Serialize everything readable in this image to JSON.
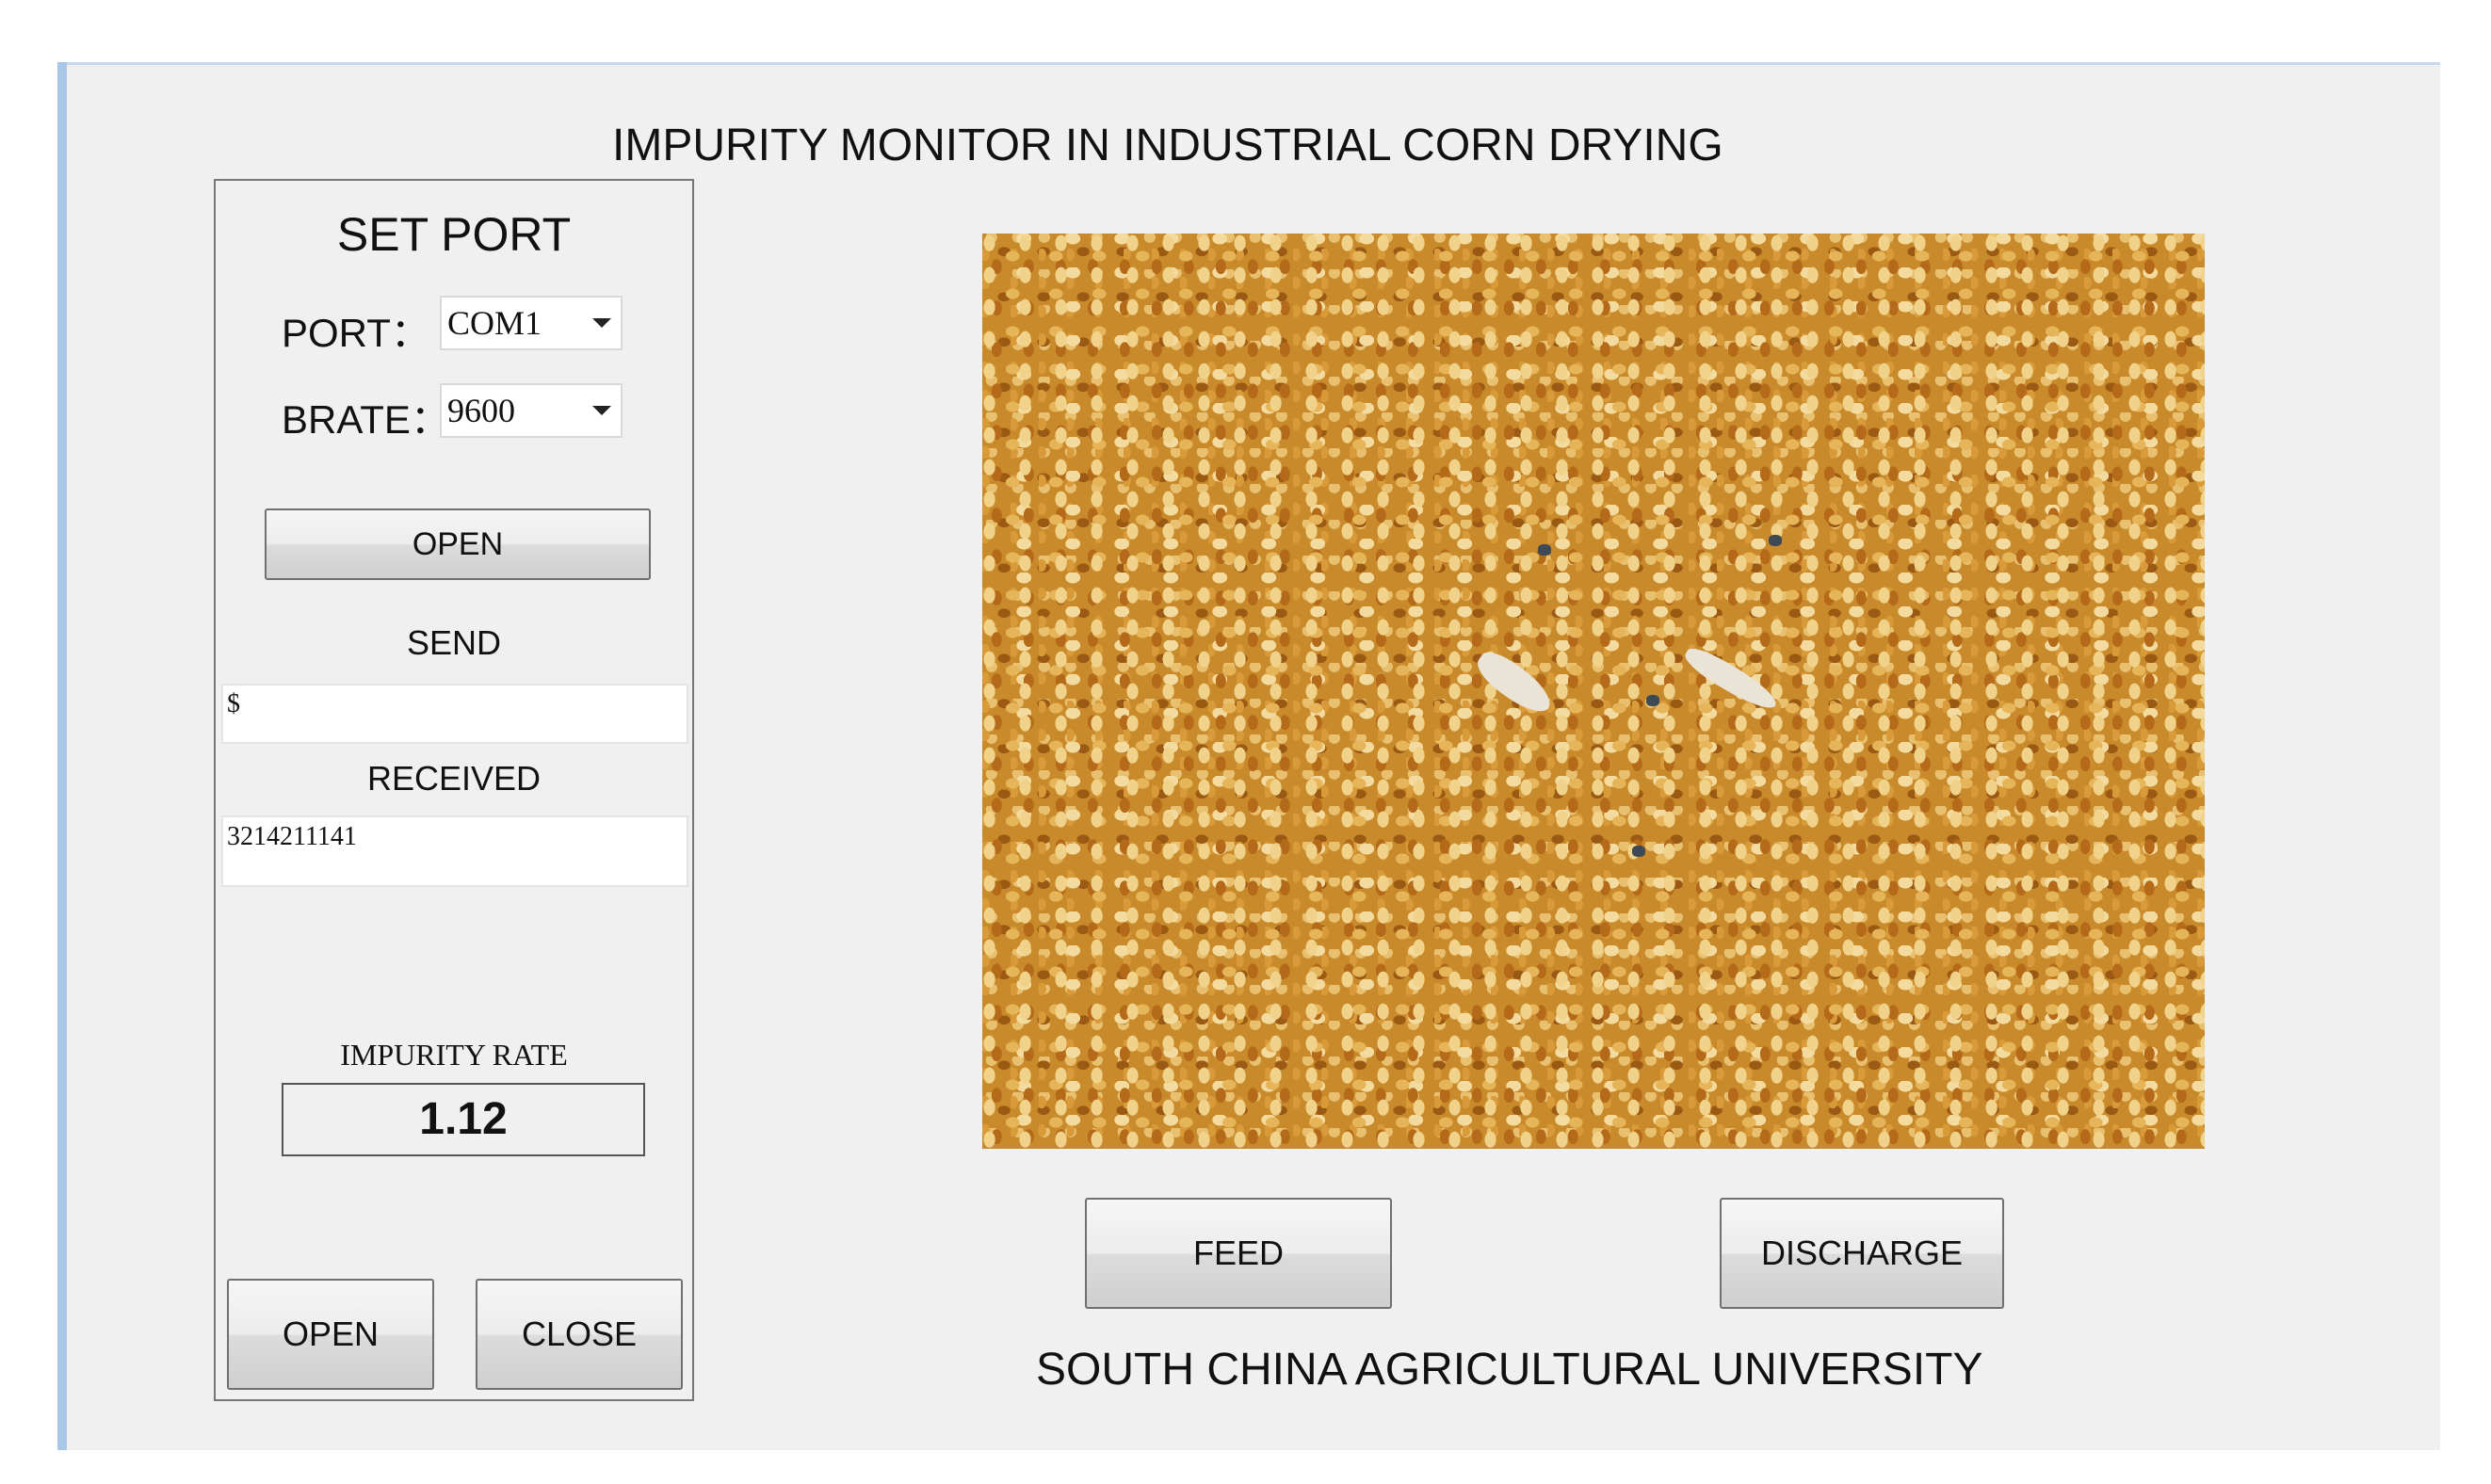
{
  "window": {
    "title": "IMPURITY MONITOR IN INDUSTRIAL CORN DRYING",
    "footer": "SOUTH CHINA AGRICULTURAL UNIVERSITY"
  },
  "port_panel": {
    "heading": "SET PORT",
    "port_label": "PORT：",
    "port_value": "COM1",
    "brate_label": "BRATE：",
    "brate_value": "9600",
    "open_port_button": "OPEN",
    "send_label": "SEND",
    "send_value": "$",
    "received_label": "RECEIVED",
    "received_value": "3214211141",
    "impurity_rate_label": "IMPURITY RATE",
    "impurity_rate_value": "1.12",
    "open_button": "OPEN",
    "close_button": "CLOSE"
  },
  "controls": {
    "feed_button": "FEED",
    "discharge_button": "DISCHARGE"
  },
  "icons": {
    "dropdown": "chevron-down-icon"
  },
  "colors": {
    "window_bg": "#f0f0f0",
    "window_border": "#a9c6e6"
  }
}
